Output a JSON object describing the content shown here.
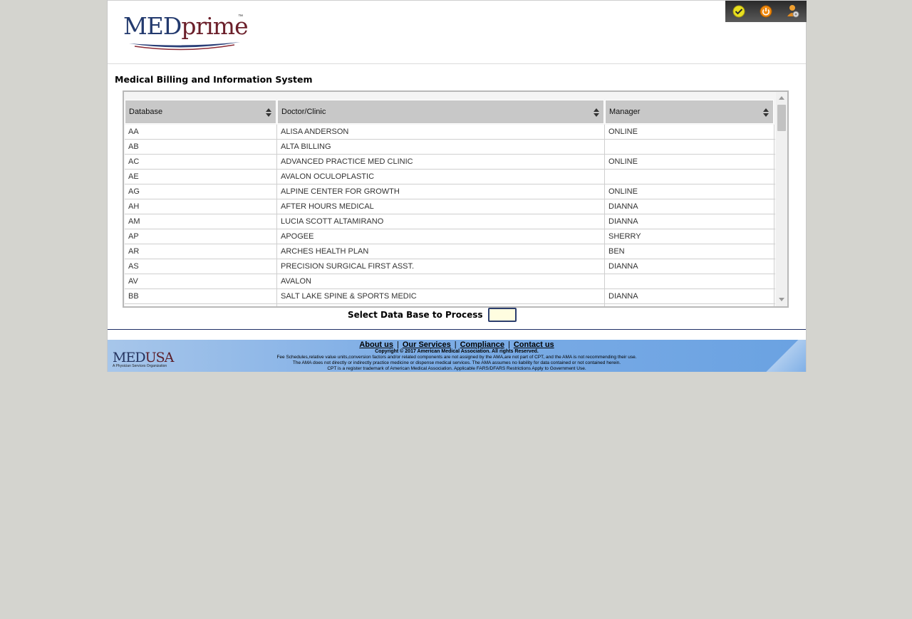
{
  "header": {
    "logo_part1": "MED",
    "logo_part2": "prime",
    "logo_tm": "™",
    "icons": [
      "check-circle-icon",
      "power-icon",
      "user-settings-icon"
    ]
  },
  "title": "Medical Billing and Information System",
  "table": {
    "columns": [
      "Database",
      "Doctor/Clinic",
      "Manager"
    ],
    "rows": [
      [
        "AA",
        "ALISA ANDERSON",
        "ONLINE"
      ],
      [
        "AB",
        "ALTA BILLING",
        ""
      ],
      [
        "AC",
        "ADVANCED PRACTICE MED CLINIC",
        "ONLINE"
      ],
      [
        "AE",
        "AVALON OCULOPLASTIC",
        ""
      ],
      [
        "AG",
        "ALPINE CENTER FOR GROWTH",
        "ONLINE"
      ],
      [
        "AH",
        "AFTER HOURS MEDICAL",
        "DIANNA"
      ],
      [
        "AM",
        "LUCIA SCOTT ALTAMIRANO",
        "DIANNA"
      ],
      [
        "AP",
        "APOGEE",
        "SHERRY"
      ],
      [
        "AR",
        "ARCHES HEALTH PLAN",
        "BEN"
      ],
      [
        "AS",
        "PRECISION SURGICAL FIRST ASST.",
        "DIANNA"
      ],
      [
        "AV",
        "AVALON",
        ""
      ],
      [
        "BB",
        "SALT LAKE SPINE & SPORTS MEDIC",
        "DIANNA"
      ],
      [
        "",
        "",
        ""
      ]
    ]
  },
  "select": {
    "label": "Select Data Base to Process",
    "value": ""
  },
  "footer": {
    "logo_part1": "MED",
    "logo_part2": "USA",
    "logo_tagline": "A Physician Services Organization",
    "links": [
      "About us",
      "Our Services",
      "Compliance",
      "Contact us"
    ],
    "separator": "|",
    "copyright": "Copyright © 2017 American Medical Association. All rights Reserved.",
    "line1": "Fee Schedules,relative value units,conversion factors and/or related components are not assigned by the AMA,are not part of CPT, and the AMA is not recommending their use.",
    "line2": "The AMA does not directly or indirectly practice medicine or dispense medical services. The AMA assumes no liability for data contained or not contained herein.",
    "line3": "CPT is a register trademark of American Medical Association. Applicable FARS/DFARS Restrictions Apply to Government Use."
  }
}
